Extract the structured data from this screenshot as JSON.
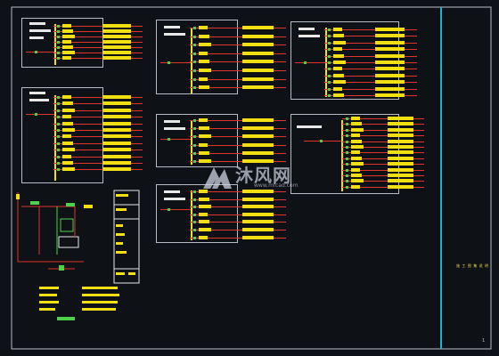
{
  "drawing": {
    "sheet_label": "施 工 图 集 说 明",
    "page_number": "1",
    "watermark_name": "沐风网",
    "watermark_url": "www.mfcad.com"
  },
  "colors": {
    "background": "#0e1116",
    "frame": "#b8bcc4",
    "circuit_line": "#e0342c",
    "label_block": "#f2e012",
    "breaker": "#4fd04a",
    "title_text": "#e8e8e8",
    "frame_accent": "#1fb3c8"
  },
  "panels": [
    {
      "id": "panel-top-left",
      "feeders": 7
    },
    {
      "id": "panel-mid-left",
      "feeders": 12
    },
    {
      "id": "panel-top-center",
      "feeders": 8
    },
    {
      "id": "panel-mid-center",
      "feeders": 6
    },
    {
      "id": "panel-bottom-center",
      "feeders": 7
    },
    {
      "id": "panel-top-right",
      "feeders": 11
    },
    {
      "id": "panel-mid-right",
      "feeders": 13
    }
  ]
}
